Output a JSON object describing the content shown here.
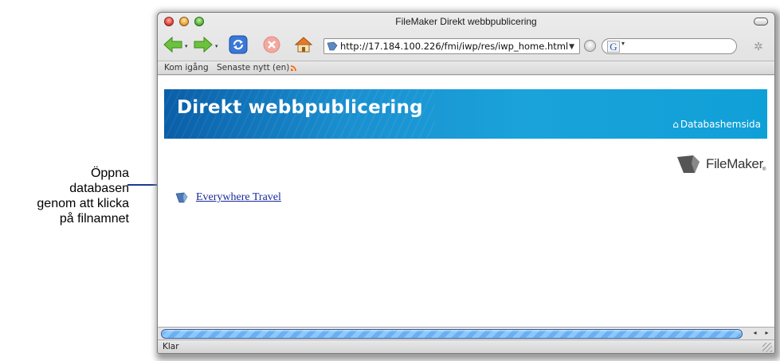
{
  "callout": {
    "lines": [
      "Öppna",
      "databasen",
      "genom att klicka",
      "på filnamnet"
    ]
  },
  "window": {
    "title": "FileMaker Direkt webbpublicering"
  },
  "toolbar": {
    "url": "http://17.184.100.226/fmi/iwp/res/iwp_home.html",
    "search_engine_badge": "G",
    "icons": [
      "back-arrow-icon",
      "forward-arrow-icon",
      "reload-icon",
      "stop-icon",
      "home-icon",
      "go-icon",
      "spinner-icon"
    ]
  },
  "bookmarks": {
    "items": [
      "Kom igång",
      "Senaste nytt (en)"
    ]
  },
  "page": {
    "banner_title": "Direkt webbpublicering",
    "home_link": "Databashemsida",
    "logo_text": "FileMaker",
    "logo_reg": "®",
    "database_link": "Everywhere Travel"
  },
  "status": {
    "text": "Klar"
  },
  "colors": {
    "banner": "#1a8fd0",
    "link": "#1a2a9a",
    "callout_line": "#1a3a8f"
  }
}
